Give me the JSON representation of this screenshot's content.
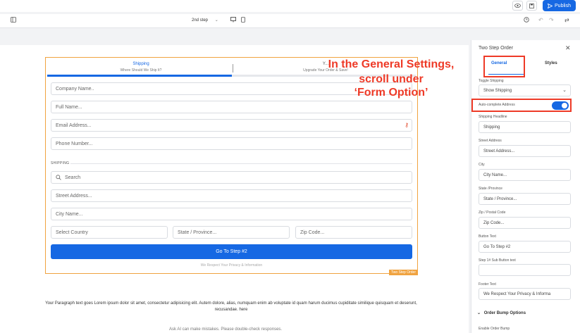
{
  "topbar": {
    "eye_icon": "eye-icon",
    "save_icon": "save-icon",
    "publish_label": "Publish"
  },
  "toolbar": {
    "step_selector": "2nd step",
    "step_chevron": "⌄"
  },
  "form": {
    "steps": [
      {
        "title": "Shipping",
        "subtitle": "Where Should We Ship It?"
      },
      {
        "title": "Y...",
        "subtitle": "Upgrade Your Order & Save!"
      }
    ],
    "fields": {
      "company": "Company Name..",
      "full_name": "Full Name...",
      "email": "Email Address...",
      "phone": "Phone Number...",
      "search": "Search",
      "street": "Street Address...",
      "city": "City Name...",
      "country": "Select Country",
      "state": "State / Province...",
      "zip": "Zip Code..."
    },
    "shipping_label": "SHIPPING",
    "go_button": "Go To Step #2",
    "footer": "We Respect Your Privacy & Information",
    "tag": "Two Step Order"
  },
  "paragraph": "Your Paragraph text goes Lorem ipsum dolor sit amet, consectetur adipisicing elit. Autem dolore, alias, numquam enim ab voluptate id quam harum ducimus cupiditate similique quisquam et deserunt, recusandae. here",
  "bottom_note": "Ask AI can make mistakes. Please double-check responses.",
  "annotation": {
    "line1": "In the General Settings,",
    "line2": "scroll under",
    "line3": "‘Form Option’"
  },
  "panel": {
    "title": "Two Step Order",
    "tabs": [
      "General",
      "Styles"
    ],
    "toggle_shipping_label": "Toggle Shipping",
    "toggle_shipping_value": "Show Shipping",
    "autocomplete_label": "Auto-complete Address",
    "autocomplete_on": true,
    "items": [
      {
        "label": "Shipping Headline",
        "value": "Shipping"
      },
      {
        "label": "Street Address",
        "value": "Street Address..."
      },
      {
        "label": "City",
        "value": "City Name..."
      },
      {
        "label": "State /Province",
        "value": "State / Province..."
      },
      {
        "label": "Zip / Postal Code",
        "value": "Zip Code..."
      },
      {
        "label": "Button Text",
        "value": "Go To Step #2"
      },
      {
        "label": "Step 1# Sub Button text",
        "value": ""
      },
      {
        "label": "Footer Text",
        "value": "We Respect Your Privacy & Informa"
      }
    ],
    "order_bump": "Order Bump Options",
    "enable_order_bump": "Enable Order Bump"
  },
  "colors": {
    "accent": "#1668e3",
    "annotation": "#ee3a27",
    "selection": "#f0a340"
  }
}
